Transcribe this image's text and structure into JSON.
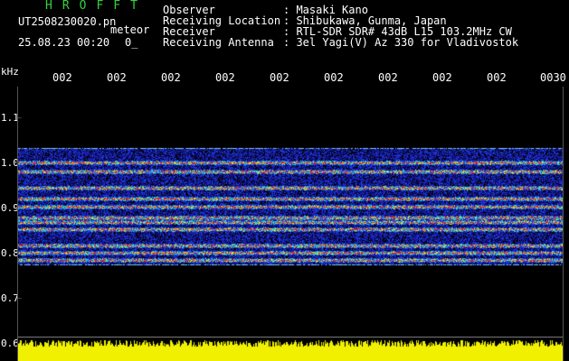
{
  "header": {
    "app_title": "HROFFT",
    "file_name": "UT2508230020.pn",
    "meteor_label": "meteor",
    "timestamp": "25.08.23 00:20",
    "count_value": "0_"
  },
  "info": [
    {
      "key": "Observer",
      "value": ": Masaki Kano"
    },
    {
      "key": "Receiving Location",
      "value": ": Shibukawa, Gunma, Japan"
    },
    {
      "key": "Receiver",
      "value": ": RTL-SDR SDR# 43dB L15 103.2MHz CW"
    },
    {
      "key": "Receiving Antenna",
      "value": ": 3el Yagi(V) Az 330 for Vladivostok"
    }
  ],
  "axis": {
    "unit_label": "kHz",
    "y_ticks": [
      "1.1",
      "1.0",
      "0.9",
      "0.8",
      "0.7",
      "0.6"
    ],
    "x_ticks": [
      "002",
      "002",
      "002",
      "002",
      "002",
      "002",
      "002",
      "002",
      "002",
      "0030"
    ]
  },
  "colors": {
    "title": "#35d23a",
    "signal_low": "#1a1ad8",
    "signal_mid": "#1ec4e0",
    "signal_high": "#e0e020",
    "signal_peak": "#e02020",
    "meteor_bar": "#f0f000"
  }
}
